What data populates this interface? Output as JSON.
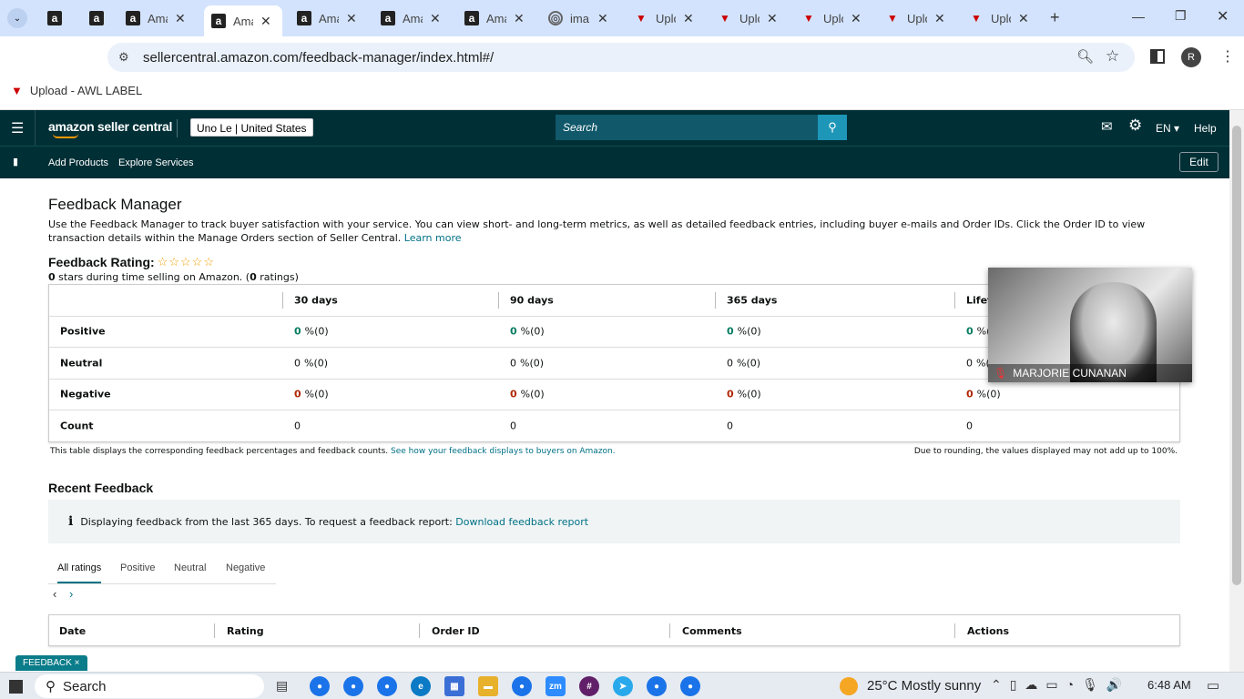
{
  "browser": {
    "tabs": [
      {
        "label": "",
        "icon": "amazon-icon"
      },
      {
        "label": "",
        "icon": "amazon-icon"
      },
      {
        "label": "Ama",
        "icon": "amazon-icon"
      },
      {
        "label": "Ama",
        "icon": "amazon-icon",
        "active": true
      },
      {
        "label": "Ama",
        "icon": "amazon-icon"
      },
      {
        "label": "Ama",
        "icon": "amazon-icon"
      },
      {
        "label": "Ama",
        "icon": "amazon-icon"
      },
      {
        "label": "ima",
        "icon": "loader-icon"
      },
      {
        "label": "Uplo",
        "icon": "upload-icon"
      },
      {
        "label": "Uplo",
        "icon": "upload-icon"
      },
      {
        "label": "Uplo",
        "icon": "upload-icon"
      },
      {
        "label": "Uplo",
        "icon": "upload-icon"
      },
      {
        "label": "Uplo",
        "icon": "upload-icon"
      }
    ],
    "url": "sellercentral.amazon.com/feedback-manager/index.html#/",
    "profile_initial": "R",
    "bookmark": "Upload - AWL LABEL"
  },
  "header": {
    "logo": "amazon seller central",
    "store": "Uno Le | United States",
    "search_placeholder": "Search",
    "language": "EN",
    "help": "Help",
    "nav": [
      "Add Products",
      "Explore Services"
    ],
    "edit": "Edit"
  },
  "page": {
    "title": "Feedback Manager",
    "description": "Use the Feedback Manager to track buyer satisfaction with your service. You can view short- and long-term metrics, as well as detailed feedback entries, including buyer e-mails and Order IDs. Click the Order ID to view transaction details within the Manage Orders section of Seller Central.",
    "learn_more": "Learn more",
    "rating_label": "Feedback Rating:",
    "stars_value": "0",
    "stars_text": "stars during time selling on Amazon. (",
    "ratings_count": "0",
    "ratings_suffix": "ratings)",
    "table": {
      "columns": [
        "30 days",
        "90 days",
        "365 days",
        "Lifetime"
      ],
      "rows": [
        {
          "label": "Positive",
          "values": [
            "0",
            "0",
            "0",
            "0"
          ],
          "suffix": "%(0)",
          "tone": "g"
        },
        {
          "label": "Neutral",
          "values": [
            "0",
            "0",
            "0",
            "0"
          ],
          "suffix": "%(0)",
          "tone": ""
        },
        {
          "label": "Negative",
          "values": [
            "0",
            "0",
            "0",
            "0"
          ],
          "suffix": "%(0)",
          "tone": "r"
        },
        {
          "label": "Count",
          "values": [
            "0",
            "0",
            "0",
            "0"
          ],
          "suffix": "",
          "tone": ""
        }
      ]
    },
    "note_left": "This table displays the corresponding feedback percentages and feedback counts.",
    "note_link": "See how your feedback displays to buyers on Amazon.",
    "note_right": "Due to rounding, the values displayed may not add up to 100%.",
    "recent_title": "Recent Feedback",
    "info_text": "Displaying feedback from the last 365 days. To request a feedback report:",
    "info_link": "Download feedback report",
    "filter_tabs": [
      "All ratings",
      "Positive",
      "Neutral",
      "Negative"
    ],
    "feed_columns": [
      "Date",
      "Rating",
      "Order ID",
      "Comments",
      "Actions"
    ],
    "feedback_tag": "FEEDBACK ×"
  },
  "video": {
    "name": "MARJORIE CUNANAN"
  },
  "taskbar": {
    "search": "Search",
    "weather": "25°C  Mostly sunny",
    "time": "6:48 AM"
  }
}
